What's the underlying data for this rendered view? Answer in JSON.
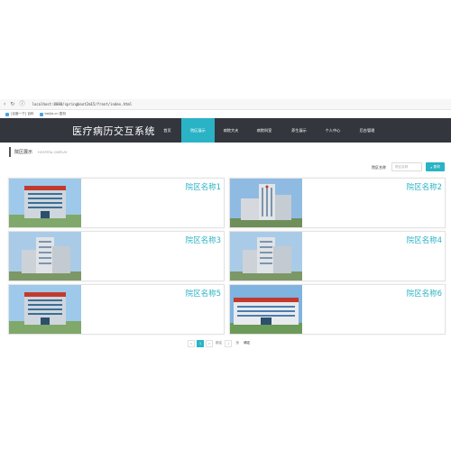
{
  "browser": {
    "url": "localhost:8080/springboot2m15/front/index.html",
    "bookmarks": [
      "[百度一下] 百科",
      "baijia.cn 复刻"
    ]
  },
  "header": {
    "brand": "医疗病历交互系统",
    "nav": [
      "首页",
      "院区展示",
      "病院大夫",
      "病院科室",
      "养生展示",
      "个人中心",
      "后台管理"
    ],
    "active_index": 1
  },
  "section": {
    "title": "院区展示",
    "subtitle": "HOSPITAL DISPLAY"
  },
  "search": {
    "label": "院区名称",
    "placeholder": "院区名称",
    "button": "查询"
  },
  "cards": [
    {
      "name": "院区名称1"
    },
    {
      "name": "院区名称2"
    },
    {
      "name": "院区名称3"
    },
    {
      "name": "院区名称4"
    },
    {
      "name": "院区名称5"
    },
    {
      "name": "院区名称6"
    }
  ],
  "pagination": {
    "prev": "<",
    "current": "1",
    "next": ">",
    "goto_label": "前往",
    "page_input": "1",
    "page_unit": "页",
    "confirm": "确定"
  },
  "colors": {
    "accent": "#29b3c5",
    "header_bg": "#33363d"
  }
}
